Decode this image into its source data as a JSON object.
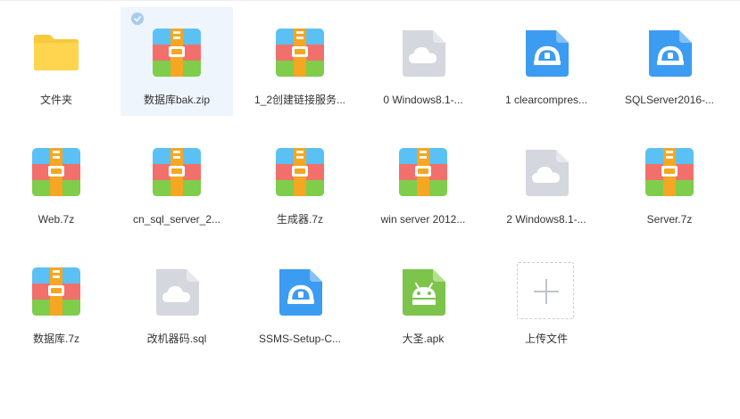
{
  "files": [
    {
      "label": "文件夹",
      "icon": "folder-icon",
      "selected": false
    },
    {
      "label": "数据库bak.zip",
      "icon": "archive-icon",
      "selected": true
    },
    {
      "label": "1_2创建链接服务...",
      "icon": "archive-icon",
      "selected": false
    },
    {
      "label": "0 Windows8.1-...",
      "icon": "cloud-file-icon",
      "selected": false
    },
    {
      "label": "1 clearcompres...",
      "icon": "installer-icon",
      "selected": false
    },
    {
      "label": "SQLServer2016-...",
      "icon": "installer-icon",
      "selected": false
    },
    {
      "label": "Web.7z",
      "icon": "archive-icon",
      "selected": false
    },
    {
      "label": "cn_sql_server_2...",
      "icon": "archive-icon",
      "selected": false
    },
    {
      "label": "生成器.7z",
      "icon": "archive-icon",
      "selected": false
    },
    {
      "label": "win server 2012...",
      "icon": "archive-icon",
      "selected": false
    },
    {
      "label": "2 Windows8.1-...",
      "icon": "cloud-file-icon",
      "selected": false
    },
    {
      "label": "Server.7z",
      "icon": "archive-icon",
      "selected": false
    },
    {
      "label": "数据库.7z",
      "icon": "archive-icon",
      "selected": false
    },
    {
      "label": "改机器码.sql",
      "icon": "cloud-file-icon",
      "selected": false
    },
    {
      "label": "SSMS-Setup-C...",
      "icon": "installer-icon",
      "selected": false
    },
    {
      "label": "大圣.apk",
      "icon": "android-icon",
      "selected": false
    }
  ],
  "upload": {
    "label": "上传文件",
    "icon": "plus-icon"
  },
  "colors": {
    "selected_bg": "#eef5fd",
    "check": "#a9cbf2",
    "folder": "#ffd54f",
    "archive_blue": "#5bc1f5",
    "archive_red": "#f1706b",
    "archive_green": "#7fcd4a",
    "archive_strap": "#f5a623",
    "cloud_file": "#d4d7dd",
    "installer": "#3c9cf2",
    "android": "#7cc44b"
  }
}
